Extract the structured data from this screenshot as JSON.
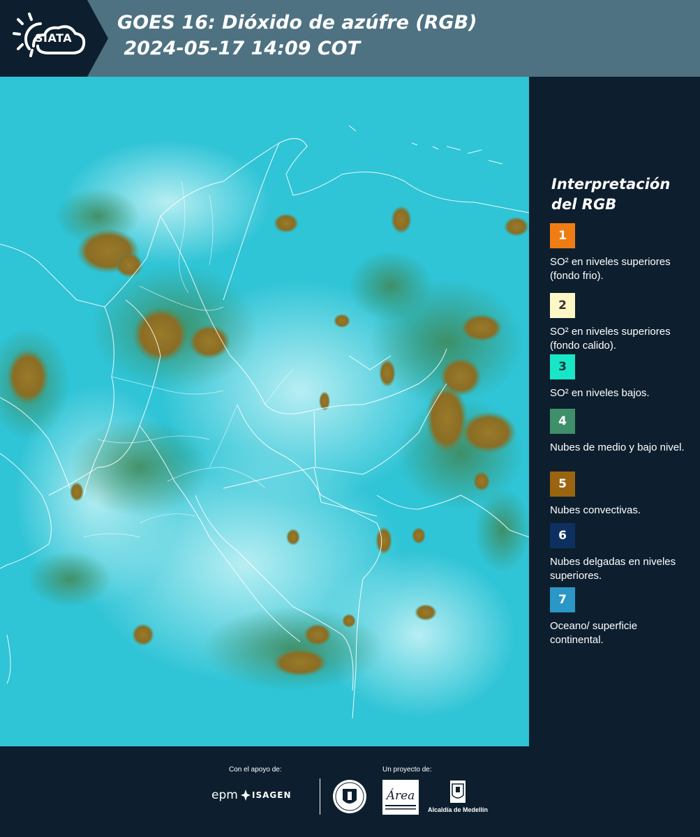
{
  "header": {
    "logo_text": "SIATA",
    "title_line1": "GOES 16: Dióxido de azúfre (RGB)",
    "title_line2": " 2024-05-17 14:09 COT"
  },
  "legend": {
    "title": "Interpretación del RGB",
    "items": [
      {
        "number": "1",
        "color": "#f07d14",
        "text_color": "#ffffff",
        "label": "SO² en niveles superiores (fondo frio)."
      },
      {
        "number": "2",
        "color": "#fdf7c6",
        "text_color": "#333333",
        "label": "SO² en niveles superiores (fondo calido)."
      },
      {
        "number": "3",
        "color": "#19e6c6",
        "text_color": "#0d3b3b",
        "label": "SO² en niveles bajos."
      },
      {
        "number": "4",
        "color": "#3f8f6b",
        "text_color": "#ffffff",
        "label": "Nubes de medio y bajo nivel."
      },
      {
        "number": "5",
        "color": "#9a6410",
        "text_color": "#ffffff",
        "label": "Nubes convectivas."
      },
      {
        "number": "6",
        "color": "#0d3061",
        "text_color": "#ffffff",
        "label": "Nubes delgadas en niveles superiores."
      },
      {
        "number": "7",
        "color": "#2b97c6",
        "text_color": "#ffffff",
        "label": "Oceano/ superficie continental."
      }
    ]
  },
  "footer": {
    "support_label": "Con el apoyo de:",
    "project_label": "Un proyecto de:",
    "epm_logo": "epm",
    "isagen_logo": "ISAGEN",
    "area_logo": "Área Metropolitana Valle de Aburrá",
    "alcaldia_logo": "Alcaldía de Medellín"
  }
}
